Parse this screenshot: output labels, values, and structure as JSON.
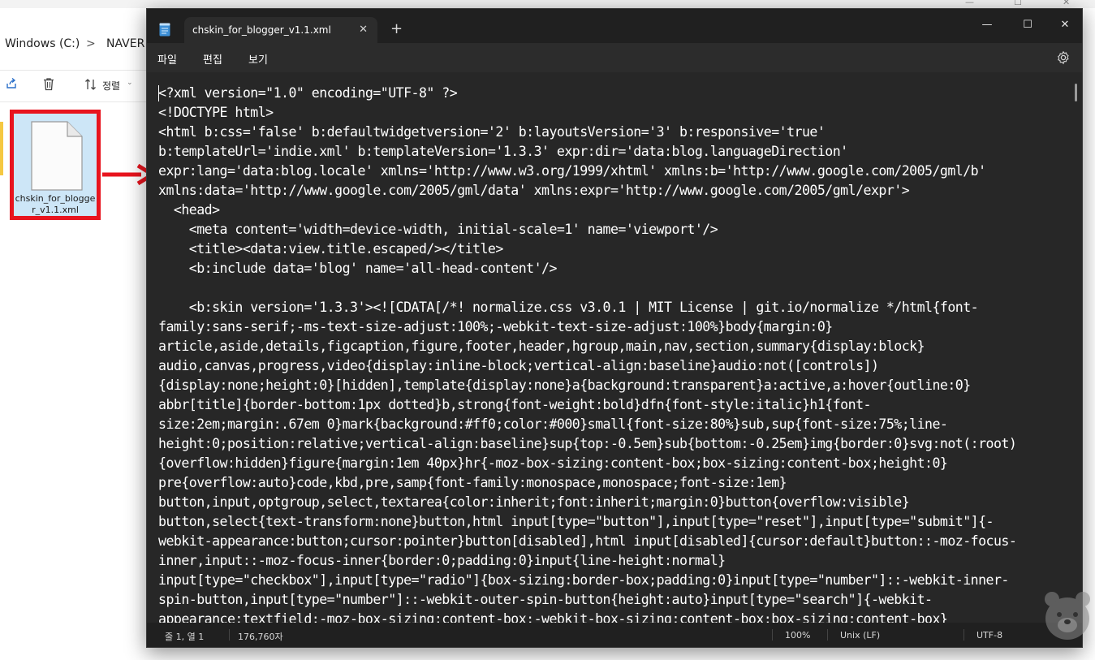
{
  "explorer": {
    "breadcrumb": [
      "Windows (C:)",
      ">",
      "NAVER"
    ],
    "toolbar": {
      "sort_label": "정렬"
    },
    "file": {
      "name": "chskin_for_blogger_v1.1.xml"
    }
  },
  "notepad": {
    "tab_title": "chskin_for_blogger_v1.1.xml",
    "tab_close": "✕",
    "new_tab": "+",
    "controls": {
      "minimize": "—",
      "maximize": "☐",
      "close": "✕"
    },
    "menu": [
      "파일",
      "편집",
      "보기"
    ],
    "code_lines": [
      "<?xml version=\"1.0\" encoding=\"UTF-8\" ?>",
      "<!DOCTYPE html>",
      "<html b:css='false' b:defaultwidgetversion='2' b:layoutsVersion='3' b:responsive='true'",
      "b:templateUrl='indie.xml' b:templateVersion='1.3.3' expr:dir='data:blog.languageDirection'",
      "expr:lang='data:blog.locale' xmlns='http://www.w3.org/1999/xhtml' xmlns:b='http://www.google.com/2005/gml/b'",
      "xmlns:data='http://www.google.com/2005/gml/data' xmlns:expr='http://www.google.com/2005/gml/expr'>",
      "  <head>",
      "    <meta content='width=device-width, initial-scale=1' name='viewport'/>",
      "    <title><data:view.title.escaped/></title>",
      "    <b:include data='blog' name='all-head-content'/>",
      "",
      "    <b:skin version='1.3.3'><![CDATA[/*! normalize.css v3.0.1 | MIT License | git.io/normalize */html{font-",
      "family:sans-serif;-ms-text-size-adjust:100%;-webkit-text-size-adjust:100%}body{margin:0}",
      "article,aside,details,figcaption,figure,footer,header,hgroup,main,nav,section,summary{display:block}",
      "audio,canvas,progress,video{display:inline-block;vertical-align:baseline}audio:not([controls])",
      "{display:none;height:0}[hidden],template{display:none}a{background:transparent}a:active,a:hover{outline:0}",
      "abbr[title]{border-bottom:1px dotted}b,strong{font-weight:bold}dfn{font-style:italic}h1{font-",
      "size:2em;margin:.67em 0}mark{background:#ff0;color:#000}small{font-size:80%}sub,sup{font-size:75%;line-",
      "height:0;position:relative;vertical-align:baseline}sup{top:-0.5em}sub{bottom:-0.25em}img{border:0}svg:not(:root)",
      "{overflow:hidden}figure{margin:1em 40px}hr{-moz-box-sizing:content-box;box-sizing:content-box;height:0}",
      "pre{overflow:auto}code,kbd,pre,samp{font-family:monospace,monospace;font-size:1em}",
      "button,input,optgroup,select,textarea{color:inherit;font:inherit;margin:0}button{overflow:visible}",
      "button,select{text-transform:none}button,html input[type=\"button\"],input[type=\"reset\"],input[type=\"submit\"]{-",
      "webkit-appearance:button;cursor:pointer}button[disabled],html input[disabled]{cursor:default}button::-moz-focus-",
      "inner,input::-moz-focus-inner{border:0;padding:0}input{line-height:normal}",
      "input[type=\"checkbox\"],input[type=\"radio\"]{box-sizing:border-box;padding:0}input[type=\"number\"]::-webkit-inner-",
      "spin-button,input[type=\"number\"]::-webkit-outer-spin-button{height:auto}input[type=\"search\"]{-webkit-",
      "appearance:textfield;-moz-box-sizing:content-box;-webkit-box-sizing:content-box;box-sizing:content-box}"
    ],
    "status": {
      "position": "줄 1, 열 1",
      "char_count": "176,760자",
      "zoom": "100%",
      "line_ending": "Unix (LF)",
      "encoding": "UTF-8"
    }
  },
  "colors": {
    "highlight_border": "#e8141e",
    "selection_bg": "#cde6f7",
    "notepad_bg": "#272727",
    "notepad_chrome": "#202020"
  }
}
